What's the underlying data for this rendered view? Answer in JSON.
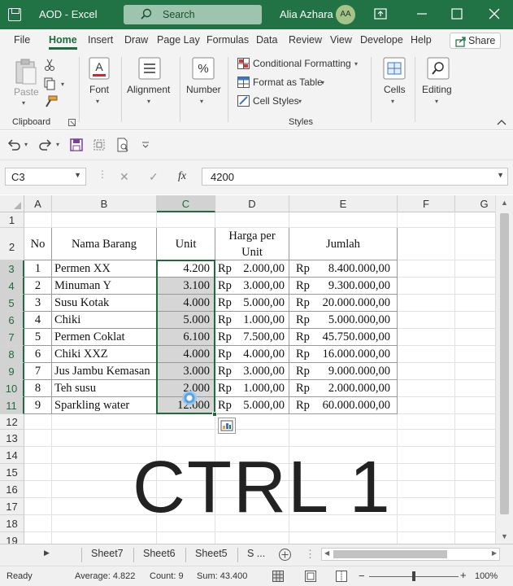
{
  "titlebar": {
    "doc_title": "AOD  -  Excel",
    "search_placeholder": "Search",
    "user_name": "Alia Azhara",
    "user_initials": "AA"
  },
  "ribbon_tabs": [
    "File",
    "Home",
    "Insert",
    "Draw",
    "Page Lay",
    "Formulas",
    "Data",
    "Review",
    "View",
    "Develope",
    "Help"
  ],
  "share_label": "Share",
  "ribbon": {
    "paste": "Paste",
    "clipboard": "Clipboard",
    "font": "Font",
    "alignment": "Alignment",
    "number": "Number",
    "conditional_formatting": "Conditional Formatting",
    "format_as_table": "Format as Table",
    "cell_styles": "Cell Styles",
    "styles": "Styles",
    "cells": "Cells",
    "editing": "Editing"
  },
  "formula_bar": {
    "name_box": "C3",
    "fx": "fx",
    "value": "4200"
  },
  "columns": [
    "A",
    "B",
    "C",
    "D",
    "E",
    "F",
    "G"
  ],
  "rows": [
    "1",
    "2",
    "3",
    "4",
    "5",
    "6",
    "7",
    "8",
    "9",
    "10",
    "11",
    "12",
    "13",
    "14",
    "15",
    "16",
    "17",
    "18",
    "19"
  ],
  "table": {
    "headers": {
      "no": "No",
      "nama": "Nama Barang",
      "unit": "Unit",
      "harga_line1": "Harga per",
      "harga_line2": "Unit",
      "jumlah": "Jumlah"
    },
    "currency": "Rp",
    "rows": [
      {
        "no": "1",
        "nama": "Permen XX",
        "unit": "4.200",
        "harga": "2.000,00",
        "jumlah": "8.400.000,00"
      },
      {
        "no": "2",
        "nama": "Minuman Y",
        "unit": "3.100",
        "harga": "3.000,00",
        "jumlah": "9.300.000,00"
      },
      {
        "no": "3",
        "nama": "Susu Kotak",
        "unit": "4.000",
        "harga": "5.000,00",
        "jumlah": "20.000.000,00"
      },
      {
        "no": "4",
        "nama": "Chiki",
        "unit": "5.000",
        "harga": "1.000,00",
        "jumlah": "5.000.000,00"
      },
      {
        "no": "5",
        "nama": "Permen Coklat",
        "unit": "6.100",
        "harga": "7.500,00",
        "jumlah": "45.750.000,00"
      },
      {
        "no": "6",
        "nama": "Chiki XXZ",
        "unit": "4.000",
        "harga": "4.000,00",
        "jumlah": "16.000.000,00"
      },
      {
        "no": "7",
        "nama": "Jus Jambu Kemasan",
        "unit": "3.000",
        "harga": "3.000,00",
        "jumlah": "9.000.000,00"
      },
      {
        "no": "8",
        "nama": "Teh susu",
        "unit": "2.000",
        "harga": "1.000,00",
        "jumlah": "2.000.000,00"
      },
      {
        "no": "9",
        "nama": "Sparkling water",
        "unit": "12.000",
        "harga": "5.000,00",
        "jumlah": "60.000.000,00"
      }
    ]
  },
  "overlay_text": "CTRL 1",
  "sheets": [
    "Sheet7",
    "Sheet6",
    "Sheet5",
    "S ..."
  ],
  "status": {
    "ready": "Ready",
    "average": "Average: 4.822",
    "count": "Count: 9",
    "sum": "Sum: 43.400",
    "zoom": "100%"
  },
  "colors": {
    "excel_green": "#217346",
    "selection": "#1e6b3c"
  }
}
